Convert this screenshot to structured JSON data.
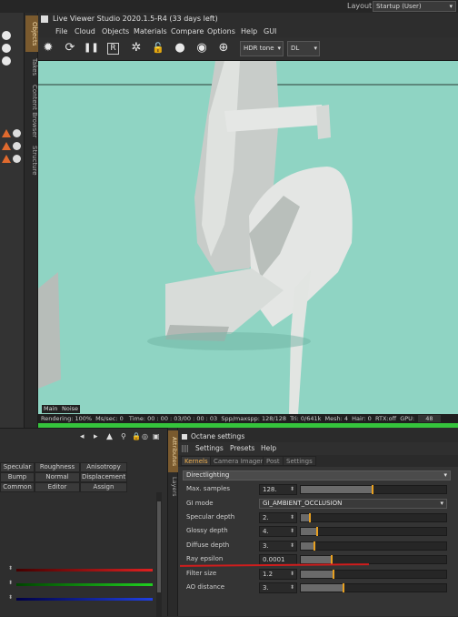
{
  "app": {
    "layout_label": "Layout:",
    "layout_value": "Startup (User)"
  },
  "left_tabs": [
    "Objects",
    "Takes",
    "Content Browser",
    "Structure"
  ],
  "viewer": {
    "title": "Live Viewer Studio 2020.1.5-R4 (33 days left)",
    "menu": [
      "File",
      "Cloud",
      "Objects",
      "Materials",
      "Compare",
      "Options",
      "Help",
      "GUI"
    ],
    "tools": [
      "sparkle-icon",
      "refresh-icon",
      "pause-icon",
      "region-icon",
      "gear-icon",
      "lock-icon",
      "sphere-icon",
      "focus-pick-icon",
      "material-pick-icon"
    ],
    "tools_glyphs": [
      "✹",
      "⟳",
      "❚❚",
      "R",
      "✲",
      "🔓",
      "●",
      "◉",
      "⊕"
    ],
    "tonemap_value": "HDR tone",
    "kernel_value": "DL",
    "viewport_tabs": [
      "Main",
      "Noise"
    ],
    "status": {
      "rendering": "Rendering: 100%",
      "ms_sec": "Ms/sec: 0",
      "time": "Time: 00 : 00 : 03/00 : 00 : 03",
      "spp": "Spp/maxspp: 128/128",
      "tri": "Tri: 0/641k",
      "mesh": "Mesh: 4",
      "hair": "Hair: 0",
      "rtx": "RTX:off",
      "gpu_label": "GPU:",
      "gpu_value": "48"
    },
    "progress": 1.0,
    "background_color": "#8fd4c3"
  },
  "material_buttons": [
    [
      "Specular",
      "Roughness",
      "Anisotropy"
    ],
    [
      "Bump",
      "Normal",
      "Displacement"
    ],
    [
      "Common",
      "Editor",
      "Assign"
    ]
  ],
  "right_tabs": [
    "Attributes",
    "Layers"
  ],
  "octane": {
    "title": "Octane settings",
    "menu": [
      "Settings",
      "Presets",
      "Help"
    ],
    "tabs": [
      "Kernels",
      "Camera Imager",
      "Post",
      "Settings"
    ],
    "kernel": "Directlighting",
    "rows": [
      {
        "label": "Max. samples",
        "value": "128.",
        "fraction": 0.5
      },
      {
        "label": "GI mode",
        "value": "GI_AMBIENT_OCCLUSION"
      },
      {
        "label": "Specular depth",
        "value": "2.",
        "fraction": 0.07
      },
      {
        "label": "Glossy depth",
        "value": "4.",
        "fraction": 0.12
      },
      {
        "label": "Diffuse depth",
        "value": "3.",
        "fraction": 0.1
      },
      {
        "label": "Ray epsilon",
        "value": "0.0001",
        "fraction": 0.22
      },
      {
        "label": "Filter size",
        "value": "1.2",
        "fraction": 0.23
      },
      {
        "label": "AO distance",
        "value": "3.",
        "fraction": 0.3
      }
    ]
  }
}
